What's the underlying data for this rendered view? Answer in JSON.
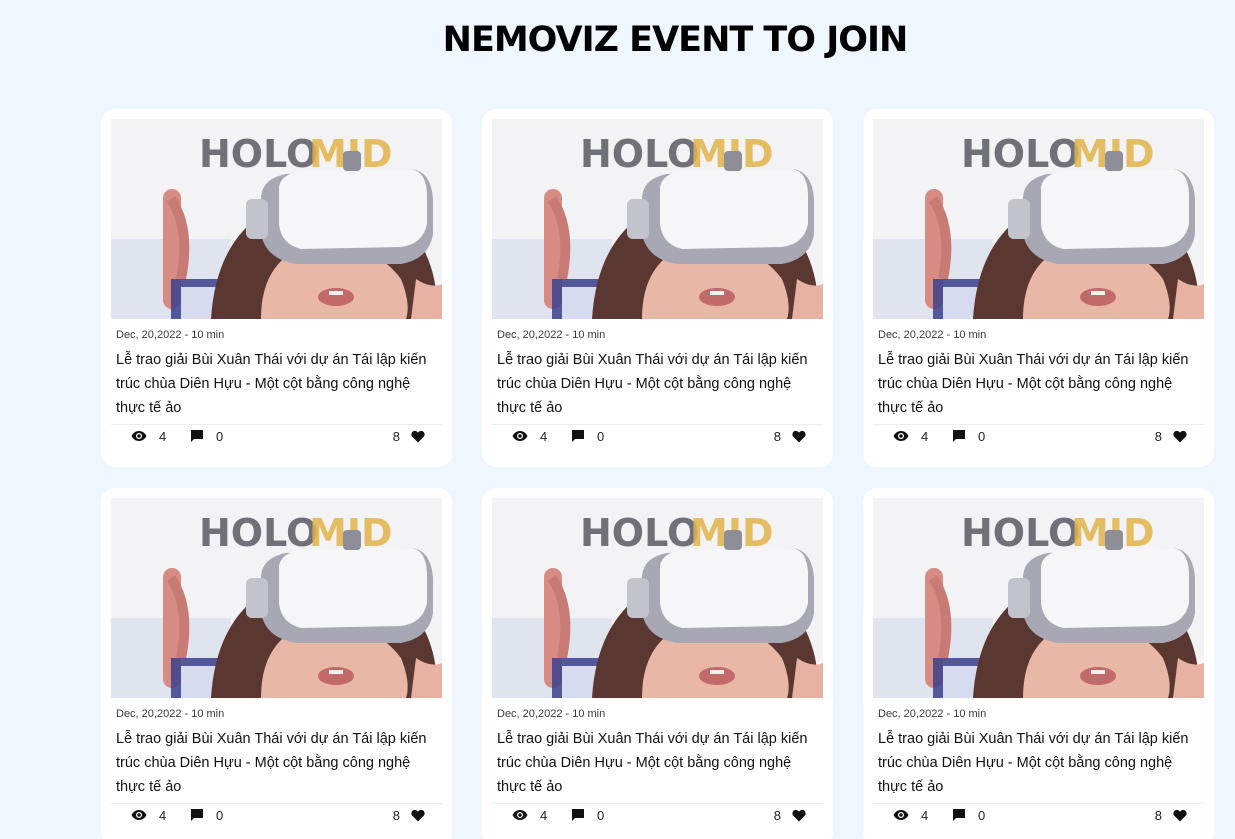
{
  "section": {
    "title": "NEMOVIZ EVENT TO JOIN"
  },
  "cards": [
    {
      "image_alt": "Person wearing VR headset",
      "image_logo_text": "HOLOMID",
      "meta": "Dec, 20,2022 - 10 min",
      "title": "Lễ trao giải Bùi Xuân Thái với dự án Tái lập kiến trúc chùa Diên Hựu - Một cột bằng công nghệ thực tế ảo",
      "views": "4",
      "comments": "0",
      "likes": "8"
    },
    {
      "image_alt": "Person wearing VR headset",
      "image_logo_text": "HOLOMID",
      "meta": "Dec, 20,2022 - 10 min",
      "title": "Lễ trao giải Bùi Xuân Thái với dự án Tái lập kiến trúc chùa Diên Hựu - Một cột bằng công nghệ thực tế ảo",
      "views": "4",
      "comments": "0",
      "likes": "8"
    },
    {
      "image_alt": "Person wearing VR headset",
      "image_logo_text": "HOLOMID",
      "meta": "Dec, 20,2022 - 10 min",
      "title": "Lễ trao giải Bùi Xuân Thái với dự án Tái lập kiến trúc chùa Diên Hựu - Một cột bằng công nghệ thực tế ảo",
      "views": "4",
      "comments": "0",
      "likes": "8"
    },
    {
      "image_alt": "Person wearing VR headset",
      "image_logo_text": "HOLOMID",
      "meta": "Dec, 20,2022 - 10 min",
      "title": "Lễ trao giải Bùi Xuân Thái với dự án Tái lập kiến trúc chùa Diên Hựu - Một cột bằng công nghệ thực tế ảo",
      "views": "4",
      "comments": "0",
      "likes": "8"
    },
    {
      "image_alt": "Person wearing VR headset",
      "image_logo_text": "HOLOMID",
      "meta": "Dec, 20,2022 - 10 min",
      "title": "Lễ trao giải Bùi Xuân Thái với dự án Tái lập kiến trúc chùa Diên Hựu - Một cột bằng công nghệ thực tế ảo",
      "views": "4",
      "comments": "0",
      "likes": "8"
    },
    {
      "image_alt": "Person wearing VR headset",
      "image_logo_text": "HOLOMID",
      "meta": "Dec, 20,2022 - 10 min",
      "title": "Lễ trao giải Bùi Xuân Thái với dự án Tái lập kiến trúc chùa Diên Hựu - Một cột bằng công nghệ thực tế ảo",
      "views": "4",
      "comments": "0",
      "likes": "8"
    }
  ],
  "icons": {
    "views": "eye-icon",
    "comments": "comment-icon",
    "likes": "heart-icon"
  },
  "colors": {
    "page_background": "#eef6ff",
    "card_background": "#ffffff",
    "text": "#111111"
  }
}
